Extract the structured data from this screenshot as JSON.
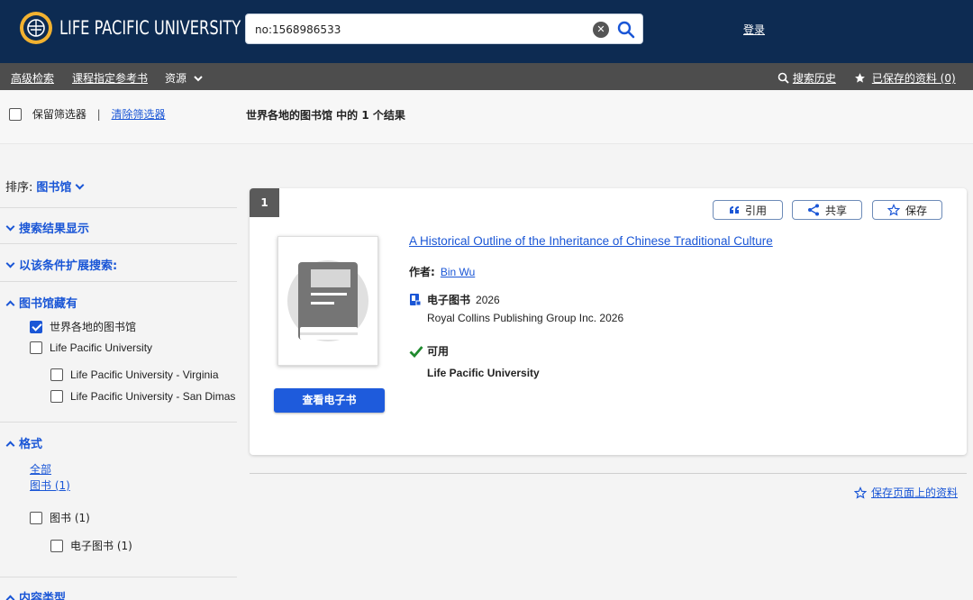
{
  "header": {
    "university_name": "LIFE PACIFIC UNIVERSITY",
    "search_value": "no:1568986533",
    "login_label": "登录"
  },
  "nav": {
    "advanced_search": "高级检索",
    "course_reserves": "课程指定参考书",
    "resources": "资源",
    "search_history": "搜索历史",
    "saved_items": "已保存的资料 (0)"
  },
  "filters": {
    "keep_filters": "保留筛选器",
    "separator": "|",
    "clear_filters": "清除筛选器",
    "results_summary": "世界各地的图书馆 中的 1 个结果"
  },
  "sidebar": {
    "sort_label": "排序:",
    "sort_value": "图书馆",
    "display_options": "搜索结果显示",
    "expand_search": "以该条件扩展搜索:",
    "held_by": "图书馆藏有",
    "libraries": [
      {
        "label": "世界各地的图书馆",
        "checked": true
      },
      {
        "label": "Life Pacific University",
        "checked": false
      },
      {
        "label": "Life Pacific University - Virginia",
        "checked": false
      },
      {
        "label": "Life Pacific University - San Dimas",
        "checked": false
      }
    ],
    "format_head": "格式",
    "format_all": "全部",
    "format_book_link": "图书 (1)",
    "format_options": [
      {
        "label": "图书 (1)",
        "checked": false
      },
      {
        "label": "电子图书 (1)",
        "checked": false
      }
    ],
    "content_type": "内容类型"
  },
  "result": {
    "index": "1",
    "cite_label": "引用",
    "share_label": "共享",
    "save_label": "保存",
    "view_ebook": "查看电子书",
    "title": "A Historical Outline of the Inheritance of Chinese Traditional Culture",
    "author_label": "作者:",
    "author": "Bin Wu",
    "format_label": "电子图书",
    "year": "2026",
    "publisher": "Royal Collins Publishing Group Inc. 2026",
    "availability": "可用",
    "available_at": "Life Pacific University"
  },
  "save_page_label": "保存页面上的资料",
  "colors": {
    "header_bg": "#0d2b52",
    "nav_bg": "#4d4d4d",
    "accent": "#1a56d6",
    "available_green": "#1f8a2e",
    "logo_gold": "#f2b230"
  }
}
